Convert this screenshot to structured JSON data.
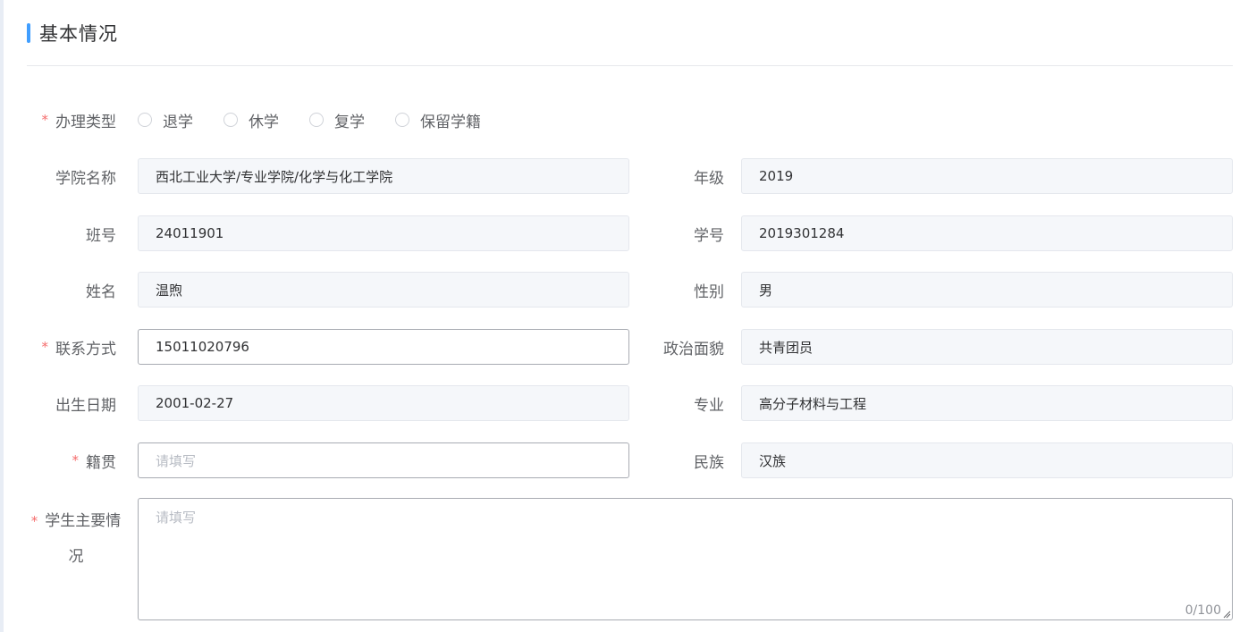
{
  "section": {
    "title": "基本情况"
  },
  "apply_type": {
    "label": "办理类型",
    "required_mark": "*",
    "options": [
      "退学",
      "休学",
      "复学",
      "保留学籍"
    ]
  },
  "fields": {
    "college": {
      "label": "学院名称",
      "value": "西北工业大学/专业学院/化学与化工学院"
    },
    "grade": {
      "label": "年级",
      "value": "2019"
    },
    "class_no": {
      "label": "班号",
      "value": "24011901"
    },
    "student_no": {
      "label": "学号",
      "value": "2019301284"
    },
    "name": {
      "label": "姓名",
      "value": "温煦"
    },
    "gender": {
      "label": "性别",
      "value": "男"
    },
    "contact": {
      "label": "联系方式",
      "value": "15011020796",
      "required_mark": "*"
    },
    "political": {
      "label": "政治面貌",
      "value": "共青团员"
    },
    "birth": {
      "label": "出生日期",
      "value": "2001-02-27"
    },
    "major": {
      "label": "专业",
      "value": "高分子材料与工程"
    },
    "native_place": {
      "label": "籍贯",
      "placeholder": "请填写",
      "required_mark": "*"
    },
    "ethnicity": {
      "label": "民族",
      "value": "汉族"
    },
    "situation": {
      "label_line1": "学生主要情",
      "label_line2": "况",
      "placeholder": "请填写",
      "counter": "0/100",
      "required_mark": "*"
    }
  },
  "colors": {
    "accent": "#409eff",
    "required": "#f56c6c",
    "readonly_bg": "#f5f7fa"
  }
}
